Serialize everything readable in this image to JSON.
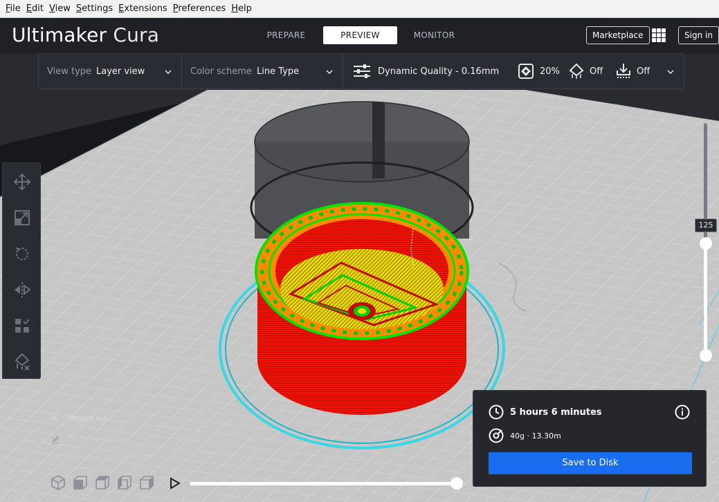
{
  "menu": [
    {
      "first": "F",
      "rest": "ile"
    },
    {
      "first": "E",
      "rest": "dit"
    },
    {
      "first": "V",
      "rest": "iew"
    },
    {
      "first": "S",
      "rest": "ettings"
    },
    {
      "first": "E",
      "rest": "xtensions"
    },
    {
      "first": "P",
      "rest": "references"
    },
    {
      "first": "H",
      "rest": "elp"
    }
  ],
  "header": {
    "logo_brand": "Ultimaker",
    "logo_product": "Cura",
    "stages": [
      "PREPARE",
      "PREVIEW",
      "MONITOR"
    ],
    "active_stage": "PREVIEW",
    "marketplace_label": "Marketplace",
    "signin_label": "Sign in",
    "apps_icon": "grid-apps-icon"
  },
  "settings_bar": {
    "view_type_label": "View type",
    "view_type_value": "Layer view",
    "color_scheme_label": "Color scheme",
    "color_scheme_value": "Line Type",
    "profile": "Dynamic Quality - 0.16mm",
    "infill": "20%",
    "support": "Off",
    "adhesion": "Off"
  },
  "left_tools": [
    "move-icon",
    "scale-icon",
    "rotate-icon",
    "mirror-icon",
    "per-model-settings-icon",
    "support-blocker-icon"
  ],
  "object_list": {
    "title": "Object list",
    "object_name": "CE3_CursedSled",
    "dimensions": "54.0 x 54.0 x 58.0 mm"
  },
  "layer_slider": {
    "current_layer": "125"
  },
  "print_info": {
    "time": "5 hours 6 minutes",
    "material": "40g · 13.30m",
    "save_label": "Save to Disk"
  },
  "colors": {
    "accent": "#196ef0",
    "wall_outer": "#ff1a00",
    "infill": "#ff8c00",
    "inner_wall": "#00e400",
    "skin": "#ffe200",
    "skirt": "#2ad9e0"
  }
}
